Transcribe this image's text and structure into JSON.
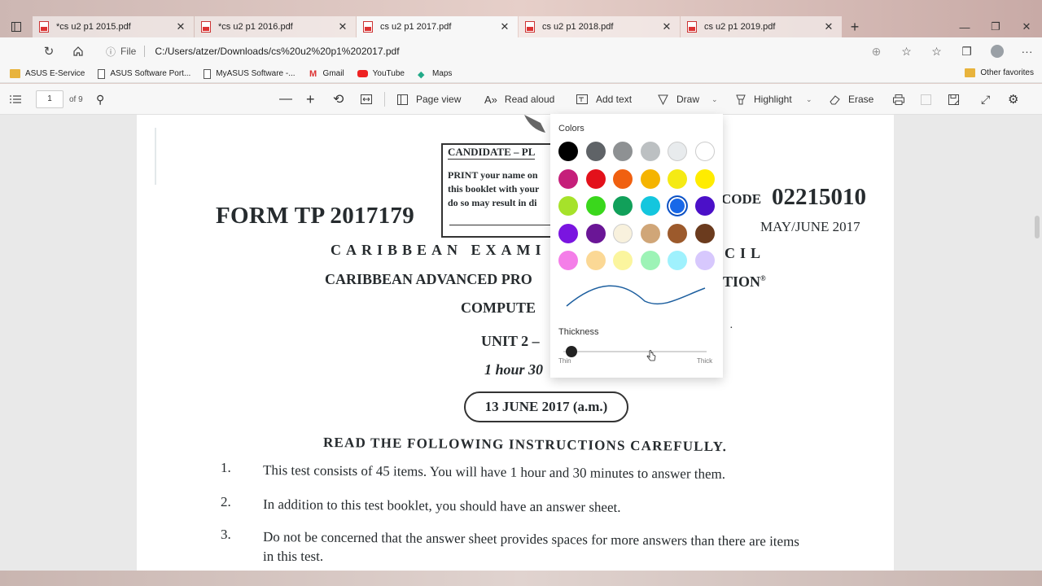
{
  "tabs": [
    {
      "title": "*cs u2 p1 2015.pdf",
      "active": false
    },
    {
      "title": "*cs u2 p1 2016.pdf",
      "active": false
    },
    {
      "title": "cs u2 p1 2017.pdf",
      "active": true
    },
    {
      "title": "cs u2 p1 2018.pdf",
      "active": false
    },
    {
      "title": "cs u2 p1 2019.pdf",
      "active": false
    }
  ],
  "address": {
    "file_label": "File",
    "url": "C:/Users/atzer/Downloads/cs%20u2%20p1%202017.pdf"
  },
  "favorites": [
    {
      "label": "ASUS E-Service",
      "icon": "folder"
    },
    {
      "label": "ASUS Software Port...",
      "icon": "page"
    },
    {
      "label": "MyASUS Software -...",
      "icon": "page"
    },
    {
      "label": "Gmail",
      "icon": "gmail"
    },
    {
      "label": "YouTube",
      "icon": "youtube"
    },
    {
      "label": "Maps",
      "icon": "maps"
    }
  ],
  "other_favorites": "Other favorites",
  "pdf_toolbar": {
    "page_number": "1",
    "page_total": "of 9",
    "page_view": "Page view",
    "read_aloud": "Read aloud",
    "add_text": "Add text",
    "draw": "Draw",
    "highlight": "Highlight",
    "erase": "Erase"
  },
  "draw_popup": {
    "colors_label": "Colors",
    "colors": [
      "#000000",
      "#5f6367",
      "#8e9193",
      "#bcc0c2",
      "#e8ebed",
      "#ffffff",
      "#c51f7a",
      "#e3111b",
      "#f06010",
      "#f5b400",
      "#f5ea14",
      "#ffec00",
      "#a6e22a",
      "#3ad71c",
      "#11a05a",
      "#14c6de",
      "#1868e8",
      "#4b10c8",
      "#7a15e0",
      "#6a1696",
      "#f8f1dd",
      "#d0a678",
      "#9c5a2c",
      "#6b3b1e",
      "#f47ee8",
      "#fbd895",
      "#fbf59e",
      "#9df3b6",
      "#9ff1fd",
      "#d7c8fd"
    ],
    "selected_index": 16,
    "thickness_label": "Thickness",
    "thin_label": "Thin",
    "thick_label": "Thick",
    "thickness_value": 0
  },
  "document": {
    "candidate_header": "CANDIDATE – PL",
    "candidate_line1": "PRINT your name on",
    "candidate_line2": "this booklet with your",
    "candidate_line3": "do so may result in di",
    "form_tp": "FORM TP 2017179",
    "code_label": "CODE",
    "code_value": "02215010",
    "session": "MAY/JUNE 2017",
    "council_left": "CARIBBEAN EXAMI",
    "council_right": "CIL",
    "capec_left": "CARIBBEAN ADVANCED PRO",
    "capec_right": "TION",
    "registered": "®",
    "subject": "COMPUTE",
    "unit": "UNIT 2 –",
    "duration": "1 hour 30",
    "exam_date": "13 JUNE 2017 (a.m.)",
    "instructions_heading": "READ THE FOLLOWING INSTRUCTIONS CAREFULLY.",
    "items": [
      {
        "num": "1.",
        "text": "This test consists of 45 items.  You will have 1 hour and 30 minutes to answer them."
      },
      {
        "num": "2.",
        "text": "In addition to this test booklet, you should have an answer sheet."
      },
      {
        "num": "3.",
        "text": "Do not be concerned that the answer sheet provides spaces for more answers than there are items",
        "text2": "in this test."
      }
    ]
  }
}
